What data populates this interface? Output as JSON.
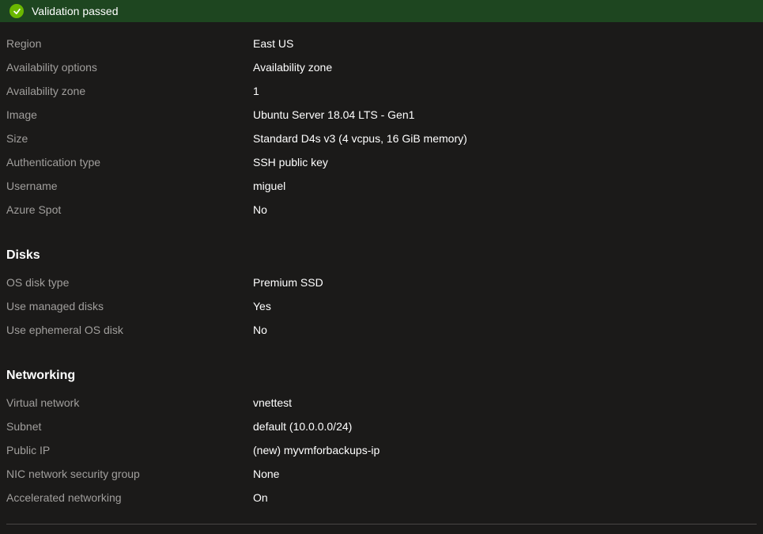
{
  "banner": {
    "message": "Validation passed"
  },
  "basics": {
    "region": {
      "label": "Region",
      "value": "East US"
    },
    "availability_options": {
      "label": "Availability options",
      "value": "Availability zone"
    },
    "availability_zone": {
      "label": "Availability zone",
      "value": "1"
    },
    "image": {
      "label": "Image",
      "value": "Ubuntu Server 18.04 LTS - Gen1"
    },
    "size": {
      "label": "Size",
      "value": "Standard D4s v3 (4 vcpus, 16 GiB memory)"
    },
    "auth_type": {
      "label": "Authentication type",
      "value": "SSH public key"
    },
    "username": {
      "label": "Username",
      "value": "miguel"
    },
    "azure_spot": {
      "label": "Azure Spot",
      "value": "No"
    }
  },
  "disks": {
    "heading": "Disks",
    "os_disk_type": {
      "label": "OS disk type",
      "value": "Premium SSD"
    },
    "managed_disks": {
      "label": "Use managed disks",
      "value": "Yes"
    },
    "ephemeral_os": {
      "label": "Use ephemeral OS disk",
      "value": "No"
    }
  },
  "networking": {
    "heading": "Networking",
    "vnet": {
      "label": "Virtual network",
      "value": "vnettest"
    },
    "subnet": {
      "label": "Subnet",
      "value": "default (10.0.0.0/24)"
    },
    "public_ip": {
      "label": "Public IP",
      "value": "(new) myvmforbackups-ip"
    },
    "nsg": {
      "label": "NIC network security group",
      "value": "None"
    },
    "accel_net": {
      "label": "Accelerated networking",
      "value": "On"
    }
  }
}
